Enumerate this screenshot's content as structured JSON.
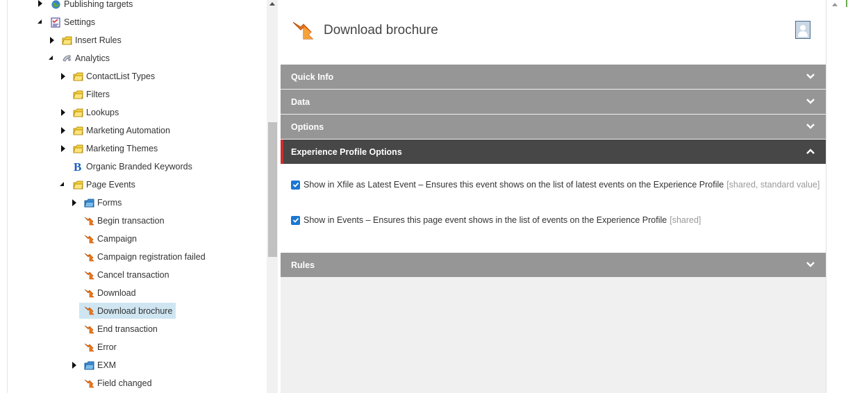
{
  "tree": {
    "items": [
      {
        "label": "Publishing targets",
        "icon": "globe-icon",
        "expander": "collapsed"
      },
      {
        "label": "Settings",
        "icon": "settings-checklist-icon",
        "expander": "expanded"
      },
      {
        "label": "Insert Rules",
        "icon": "folder-icon",
        "expander": "collapsed"
      },
      {
        "label": "Analytics",
        "icon": "analytics-satellite-icon",
        "expander": "expanded"
      },
      {
        "label": "ContactList Types",
        "icon": "folder-icon",
        "expander": "collapsed"
      },
      {
        "label": "Filters",
        "icon": "folder-icon",
        "expander": "none"
      },
      {
        "label": "Lookups",
        "icon": "folder-icon",
        "expander": "collapsed"
      },
      {
        "label": "Marketing Automation",
        "icon": "folder-icon",
        "expander": "collapsed"
      },
      {
        "label": "Marketing Themes",
        "icon": "folder-icon",
        "expander": "collapsed"
      },
      {
        "label": "Organic Branded Keywords",
        "icon": "bing-b-icon",
        "expander": "none"
      },
      {
        "label": "Page Events",
        "icon": "folder-icon",
        "expander": "expanded"
      },
      {
        "label": "Forms",
        "icon": "blue-folder-icon",
        "expander": "collapsed"
      },
      {
        "label": "Begin transaction",
        "icon": "page-event-arrow-icon",
        "expander": "none"
      },
      {
        "label": "Campaign",
        "icon": "page-event-arrow-icon",
        "expander": "none"
      },
      {
        "label": "Campaign registration failed",
        "icon": "page-event-arrow-icon",
        "expander": "none"
      },
      {
        "label": "Cancel transaction",
        "icon": "page-event-arrow-icon",
        "expander": "none"
      },
      {
        "label": "Download",
        "icon": "page-event-arrow-icon",
        "expander": "none"
      },
      {
        "label": "Download brochure",
        "icon": "page-event-arrow-icon",
        "expander": "none",
        "selected": true
      },
      {
        "label": "End transaction",
        "icon": "page-event-arrow-icon",
        "expander": "none"
      },
      {
        "label": "Error",
        "icon": "page-event-arrow-icon",
        "expander": "none"
      },
      {
        "label": "EXM",
        "icon": "blue-folder-icon",
        "expander": "collapsed"
      },
      {
        "label": "Field changed",
        "icon": "page-event-arrow-icon",
        "expander": "none"
      }
    ]
  },
  "header": {
    "title": "Download brochure",
    "icon": "page-event-arrow-icon",
    "avatar_icon": "user-avatar-icon"
  },
  "sections": [
    {
      "label": "Quick Info",
      "state": "collapsed"
    },
    {
      "label": "Data",
      "state": "collapsed"
    },
    {
      "label": "Options",
      "state": "collapsed"
    },
    {
      "label": "Experience Profile Options",
      "state": "expanded"
    },
    {
      "label": "Rules",
      "state": "collapsed"
    }
  ],
  "experience_profile_options": [
    {
      "checked": true,
      "label": "Show in Xfile as Latest Event – Ensures this event shows on the list of latest events on the Experience Profile",
      "note": "[shared, standard value]"
    },
    {
      "checked": true,
      "label": "Show in Events – Ensures this page event shows in the list of events on the Experience Profile",
      "note": "[shared]"
    }
  ],
  "colors": {
    "section_bg": "#969696",
    "section_active_bg": "#474747",
    "section_active_accent": "#d02b2b",
    "checkbox": "#1b76d2",
    "selected_row": "#cfe6f2"
  }
}
